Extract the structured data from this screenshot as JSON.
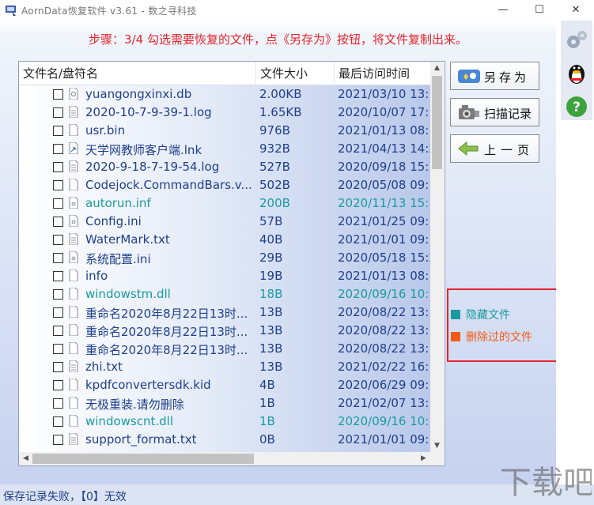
{
  "window": {
    "title": "AornData恢复软件 v3.61    -  数之寻科技",
    "minimize_label": "—",
    "maximize_label": "☐",
    "close_label": "✕"
  },
  "step_text": "步骤：3/4 勾选需要恢复的文件，点《另存为》按钮，将文件复制出来。",
  "columns": {
    "name": "文件名/盘符名",
    "size": "文件大小",
    "date": "最后访问时间"
  },
  "files": [
    {
      "name": "yuangongxinxi.db",
      "size": "2.00KB",
      "date": "2021/03/10 13:",
      "hidden": false,
      "icon": "db-file-icon"
    },
    {
      "name": "2020-10-7-9-39-1.log",
      "size": "1.65KB",
      "date": "2020/10/07 17:",
      "hidden": false,
      "icon": "text-file-icon"
    },
    {
      "name": "usr.bin",
      "size": "976B",
      "date": "2021/01/13 08:",
      "hidden": false,
      "icon": "blank-file-icon"
    },
    {
      "name": "天学网教师客户端.lnk",
      "size": "932B",
      "date": "2021/04/13 14:2",
      "hidden": false,
      "icon": "shortcut-file-icon"
    },
    {
      "name": "2020-9-18-7-19-54.log",
      "size": "527B",
      "date": "2020/09/18 15:",
      "hidden": false,
      "icon": "text-file-icon"
    },
    {
      "name": "Codejock.CommandBars.v...",
      "size": "502B",
      "date": "2020/05/08 09:",
      "hidden": false,
      "icon": "blank-file-icon"
    },
    {
      "name": "autorun.inf",
      "size": "200B",
      "date": "2020/11/13 15:",
      "hidden": true,
      "icon": "settings-file-icon"
    },
    {
      "name": "Config.ini",
      "size": "57B",
      "date": "2021/01/25 09:",
      "hidden": false,
      "icon": "settings-file-icon"
    },
    {
      "name": "WaterMark.txt",
      "size": "40B",
      "date": "2021/01/01 09:",
      "hidden": false,
      "icon": "text-file-icon"
    },
    {
      "name": "系统配置.ini",
      "size": "29B",
      "date": "2020/05/18 15:2",
      "hidden": false,
      "icon": "settings-file-icon"
    },
    {
      "name": "info",
      "size": "19B",
      "date": "2021/01/13 08:",
      "hidden": false,
      "icon": "blank-file-icon"
    },
    {
      "name": "windowstm.dll",
      "size": "18B",
      "date": "2020/09/16 10:",
      "hidden": true,
      "icon": "blank-file-icon"
    },
    {
      "name": "重命名2020年8月22日13时...",
      "size": "13B",
      "date": "2020/08/22 13:",
      "hidden": false,
      "icon": "blank-file-icon"
    },
    {
      "name": "重命名2020年8月22日13时...",
      "size": "13B",
      "date": "2020/08/22 13:",
      "hidden": false,
      "icon": "blank-file-icon"
    },
    {
      "name": "重命名2020年8月22日13时...",
      "size": "13B",
      "date": "2020/08/22 13:",
      "hidden": false,
      "icon": "blank-file-icon"
    },
    {
      "name": "zhi.txt",
      "size": "13B",
      "date": "2021/02/22 16:",
      "hidden": false,
      "icon": "text-file-icon"
    },
    {
      "name": "kpdfconvertersdk.kid",
      "size": "4B",
      "date": "2020/06/29 09:",
      "hidden": false,
      "icon": "blank-file-icon"
    },
    {
      "name": "无极重装.请勿删除",
      "size": "1B",
      "date": "2021/02/07 13:",
      "hidden": false,
      "icon": "blank-file-icon"
    },
    {
      "name": "windowscnt.dll",
      "size": "1B",
      "date": "2020/09/16 10:",
      "hidden": true,
      "icon": "blank-file-icon"
    },
    {
      "name": "support_format.txt",
      "size": "0B",
      "date": "2021/01/01 09:",
      "hidden": false,
      "icon": "text-file-icon"
    }
  ],
  "buttons": {
    "save_as": "另存为",
    "scan_record": "扫描记录",
    "previous": "上一页"
  },
  "legend": {
    "hidden_label": "隐藏文件",
    "deleted_label": "删除过的文件"
  },
  "status": "保存记录失败，【0】无效",
  "watermark_text": "下载吧",
  "colors": {
    "accent_red": "#e3262c",
    "hidden_teal": "#1a9a9f",
    "deleted_orange": "#f25b14",
    "file_text": "#1f3f8a"
  }
}
